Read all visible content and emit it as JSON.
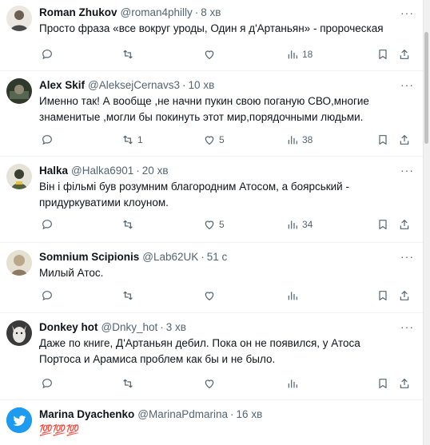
{
  "tweets": [
    {
      "name": "Roman Zhukov",
      "handle": "@roman4philly",
      "time": "8 хв",
      "text": "Просто фраза «все вокруг уроды, Один я д'Артаньян» - пророческая",
      "replies": "",
      "retweets": "",
      "likes": "",
      "views": "18",
      "avatar_color": "#e9e4dc"
    },
    {
      "name": "Alex Skif",
      "handle": "@AleksejCernavs3",
      "time": "10 хв",
      "text": "Именно так! А вообще ,не начни пукин свою поганую СВО,многие знаменитые ,могли бы покинуть этот мир,порядочными людьми.",
      "replies": "",
      "retweets": "1",
      "likes": "5",
      "views": "38",
      "avatar_color": "#3d4a3a"
    },
    {
      "name": "Halka",
      "handle": "@Halka6901",
      "time": "20 хв",
      "text": "Він і фільмі був розумним благородним Атосом, а боярський - придуркуватими клоуном.",
      "replies": "",
      "retweets": "",
      "likes": "5",
      "views": "34",
      "avatar_color": "#2f3b2a"
    },
    {
      "name": "Somnium Scipionis",
      "handle": "@Lab62UK",
      "time": "51 с",
      "text": "Милый Атос.",
      "replies": "",
      "retweets": "",
      "likes": "",
      "views": "",
      "avatar_color": "#d9d2c4"
    },
    {
      "name": "Donkey hot",
      "handle": "@Dnky_hot",
      "time": "3 хв",
      "text": "Даже по книге, Д'Артаньян дебил. Пока он не появился, у Атоса Портоса и Арамиса проблем как бы и не было.",
      "replies": "",
      "retweets": "",
      "likes": "",
      "views": "",
      "avatar_color": "#8a8a8a"
    },
    {
      "name": "Marina Dyachenko",
      "handle": "@MarinaPdmarina",
      "time": "16 хв",
      "text": "💯💯💯",
      "replies": "",
      "retweets": "",
      "likes": "",
      "views": "",
      "avatar_color": "#1d9bf0"
    }
  ]
}
